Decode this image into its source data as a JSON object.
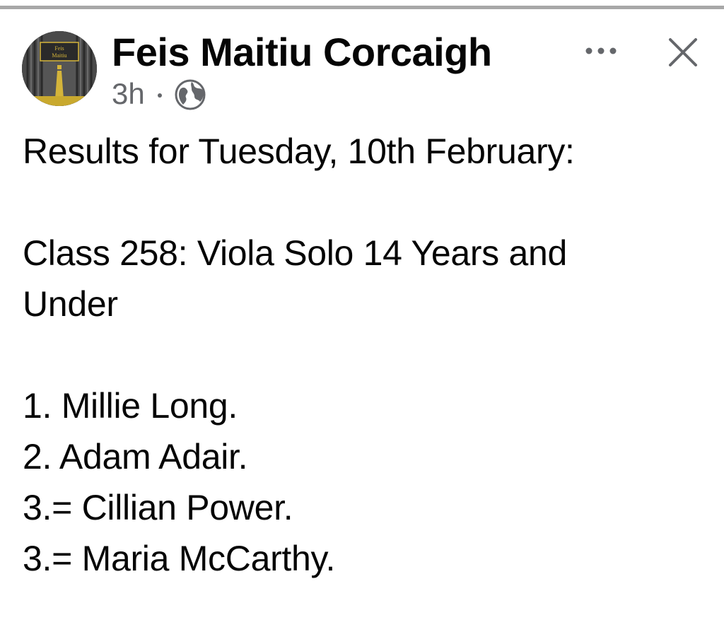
{
  "post": {
    "page_name": "Feis Maitiu Corcaigh",
    "avatar_sign_text": "Feis Maitiu",
    "time_ago": "3h",
    "audience_icon": "globe-icon",
    "actions": {
      "more_icon": "ellipsis-icon",
      "close_icon": "close-icon"
    },
    "body": {
      "heading": "Results for Tuesday, 10th February:",
      "class_title_line1": "Class 258: Viola Solo 14 Years and",
      "class_title_line2": "Under",
      "results": [
        "1. Millie Long.",
        "2. Adam Adair.",
        "3.= Cillian Power.",
        "3.= Maria McCarthy."
      ]
    }
  },
  "colors": {
    "text_primary": "#050505",
    "text_secondary": "#65676b",
    "divider": "#a8a8a8",
    "avatar_stage": "#3c3c3c",
    "avatar_gold": "#d4b43a"
  }
}
